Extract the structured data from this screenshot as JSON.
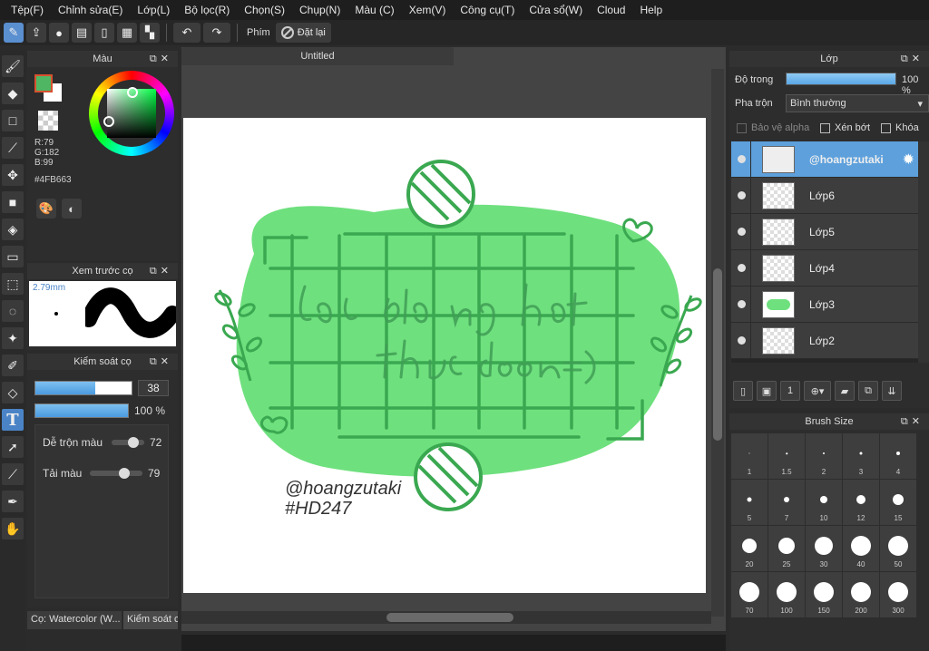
{
  "menu": [
    "Tệp(F)",
    "Chỉnh sửa(E)",
    "Lớp(L)",
    "Bộ lọc(R)",
    "Chọn(S)",
    "Chụp(N)",
    "Màu (C)",
    "Xem(V)",
    "Công cụ(T)",
    "Cửa sổ(W)",
    "Cloud",
    "Help"
  ],
  "toolbar": {
    "label": "Phím",
    "reset_label": "Đặt lại"
  },
  "color_panel": {
    "title": "Màu",
    "r": "R:79",
    "g": "G:182",
    "b": "B:99",
    "hex": "#4FB663",
    "fg_color": "#4fb663"
  },
  "brush_preview": {
    "title": "Xem trước cọ",
    "size": "2.79mm"
  },
  "brush_control": {
    "title": "Kiểm soát cọ",
    "size_value": "38",
    "size_fraction": 0.62,
    "opacity_value": "100 %",
    "opacity_fraction": 1.0,
    "mix_label": "Dễ trộn màu",
    "mix_value": "72",
    "load_label": "Tải màu",
    "load_value": "79"
  },
  "bottom_tabs": [
    "Cọ: Watercolor (W...",
    "Kiểm soát c"
  ],
  "document": {
    "tab": "Untitled",
    "signature_line1": "@hoangzutaki",
    "signature_line2": "#HD247"
  },
  "layer_panel": {
    "title": "Lớp",
    "opacity_label": "Độ trong",
    "opacity_value": "100 %",
    "blend_label": "Pha trộn",
    "blend_value": "Bình thường",
    "protect_alpha": "Bảo vệ alpha",
    "clipping": "Xén bớt",
    "lock": "Khóa",
    "layers": [
      {
        "name": "@hoangzutaki",
        "selected": true
      },
      {
        "name": "Lớp6",
        "selected": false
      },
      {
        "name": "Lớp5",
        "selected": false
      },
      {
        "name": "Lớp4",
        "selected": false
      },
      {
        "name": "Lớp3",
        "selected": false
      },
      {
        "name": "Lớp2",
        "selected": false
      }
    ]
  },
  "brush_size": {
    "title": "Brush Size",
    "sizes": [
      "1",
      "1.5",
      "2",
      "3",
      "4",
      "5",
      "7",
      "10",
      "12",
      "15",
      "20",
      "25",
      "30",
      "40",
      "50",
      "70",
      "100",
      "150",
      "200",
      "300"
    ]
  }
}
